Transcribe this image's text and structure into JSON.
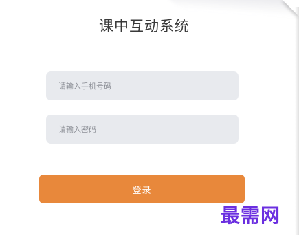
{
  "app": {
    "title": "课中互动系统"
  },
  "login_form": {
    "phone_placeholder": "请输入手机号码",
    "password_placeholder": "请输入密码",
    "submit_label": "登录"
  },
  "watermark": {
    "text": "最需网"
  },
  "colors": {
    "accent": "#e8883b",
    "field_background": "#e8eaee",
    "watermark": "#6b2fe0"
  }
}
